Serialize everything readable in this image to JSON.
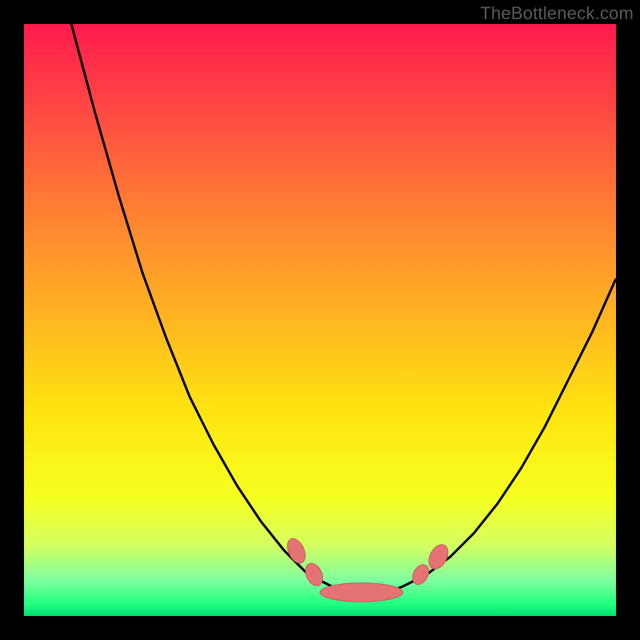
{
  "watermark": "TheBottleneck.com",
  "colors": {
    "page_bg": "#000000",
    "curve_stroke": "#000000",
    "marker_fill": "#e57373",
    "marker_stroke": "#c85a5a"
  },
  "chart_data": {
    "type": "line",
    "title": "",
    "xlabel": "",
    "ylabel": "",
    "xlim": [
      0,
      100
    ],
    "ylim": [
      0,
      100
    ],
    "grid": false,
    "legend": false,
    "background": "rainbow-gradient (red→yellow→green, top→bottom)",
    "series": [
      {
        "name": "left-branch",
        "x": [
          8,
          12,
          16,
          20,
          24,
          28,
          32,
          36,
          40,
          44,
          48,
          50,
          52
        ],
        "y": [
          100,
          85,
          71,
          58,
          47,
          37,
          29,
          22,
          16,
          11,
          7,
          6,
          5
        ]
      },
      {
        "name": "valley",
        "x": [
          52,
          54,
          56,
          58,
          60,
          62,
          64
        ],
        "y": [
          5,
          4.2,
          4,
          4,
          4,
          4.2,
          5
        ]
      },
      {
        "name": "right-branch",
        "x": [
          64,
          68,
          72,
          76,
          80,
          84,
          88,
          92,
          96,
          100
        ],
        "y": [
          5,
          7,
          10,
          14,
          19,
          25,
          32,
          40,
          48,
          57
        ]
      }
    ],
    "markers": [
      {
        "name": "left-upper",
        "x": 46,
        "y": 11,
        "rx": 1.3,
        "ry": 2.2,
        "angle": -25
      },
      {
        "name": "left-lower",
        "x": 49,
        "y": 7,
        "rx": 1.3,
        "ry": 2.0,
        "angle": -25
      },
      {
        "name": "valley-blob",
        "x": 57,
        "y": 4,
        "rx": 7.0,
        "ry": 1.6,
        "angle": 0
      },
      {
        "name": "right-lower",
        "x": 67,
        "y": 7,
        "rx": 1.2,
        "ry": 1.8,
        "angle": 28
      },
      {
        "name": "right-upper",
        "x": 70,
        "y": 10,
        "rx": 1.4,
        "ry": 2.2,
        "angle": 28
      }
    ]
  }
}
